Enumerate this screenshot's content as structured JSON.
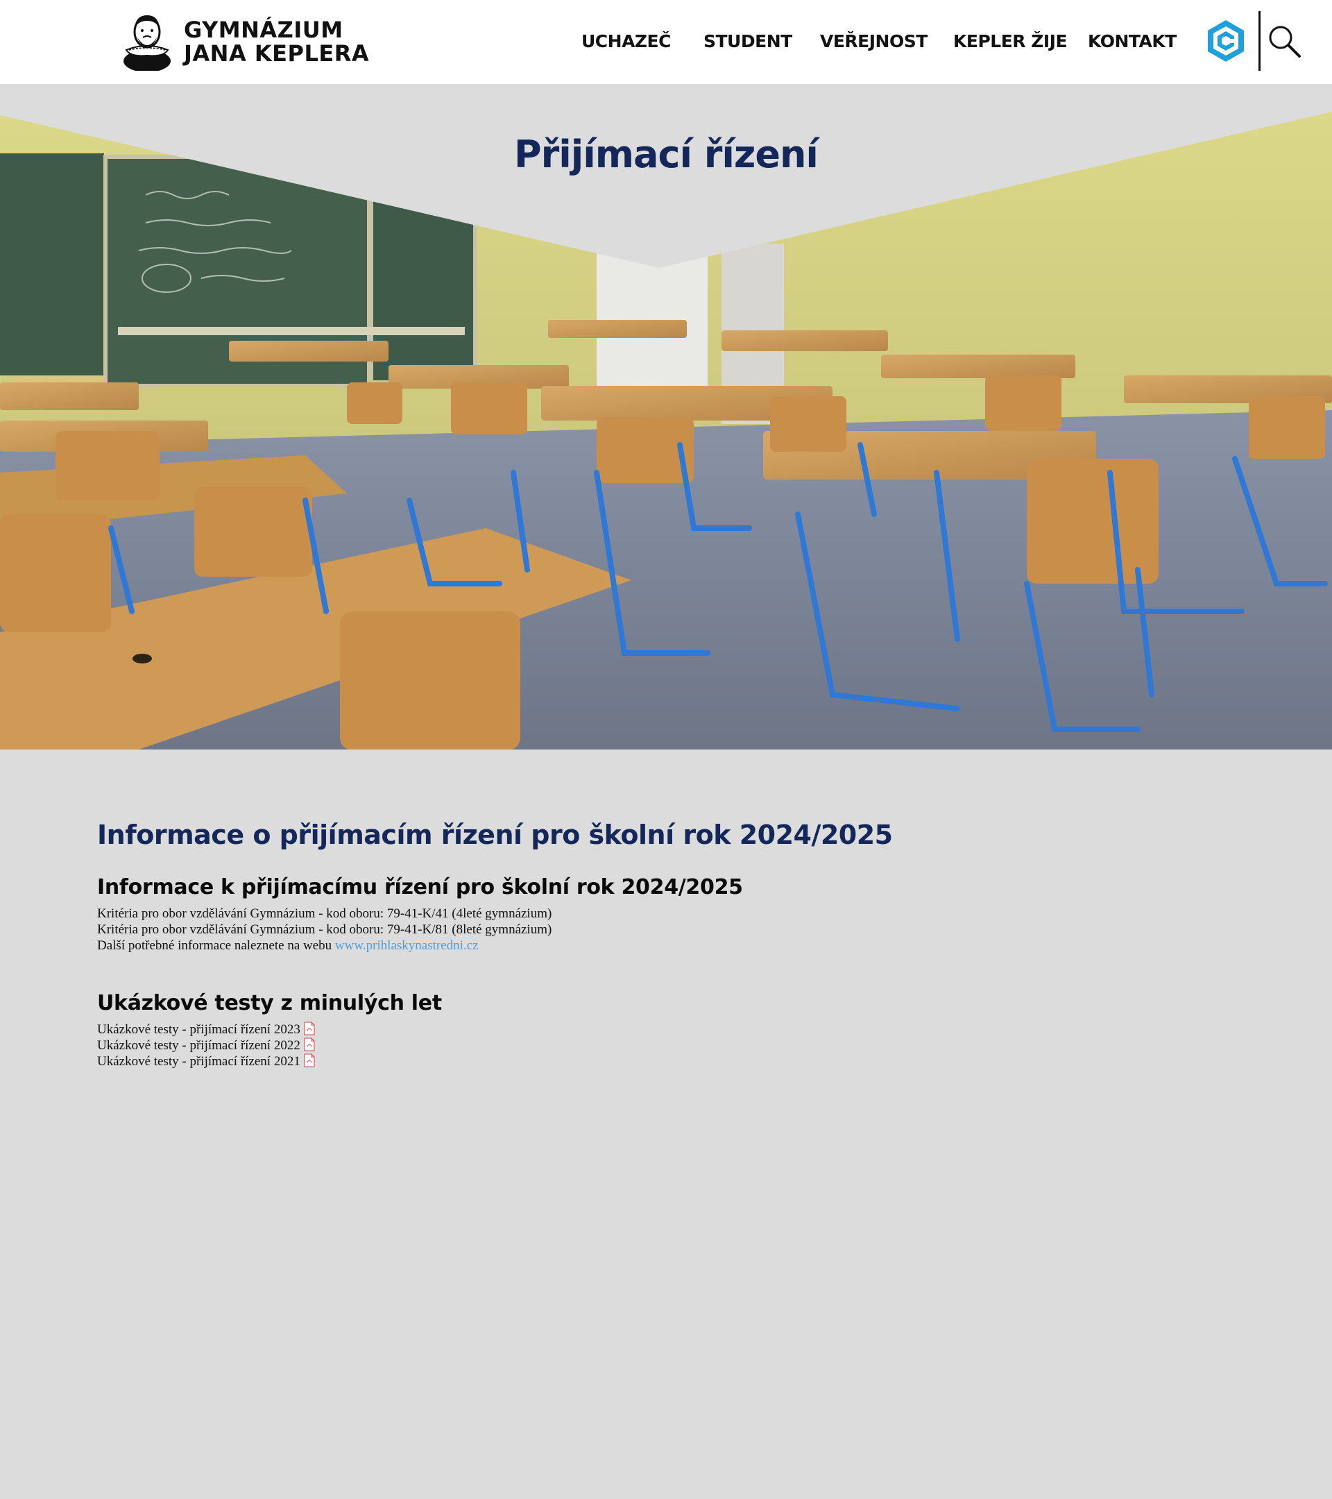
{
  "header": {
    "logo_line1": "GYMNÁZIUM",
    "logo_line2": "JANA KEPLERA",
    "nav": [
      {
        "label": "UCHAZEČ"
      },
      {
        "label": "STUDENT"
      },
      {
        "label": "VEŘEJNOST"
      },
      {
        "label": "KEPLER ŽIJE"
      },
      {
        "label": "KONTAKT"
      }
    ],
    "icons": {
      "bakalari": "bakalari-hexagon-icon",
      "search": "search-icon"
    }
  },
  "hero": {
    "title": "Přijímací řízení",
    "image": "classroom-photo"
  },
  "main": {
    "heading": "Informace o přijímacím řízení pro školní rok 2024/2025",
    "section1": {
      "heading": "Informace k přijímacímu řízení pro školní rok 2024/2025",
      "lines": [
        "Kritéria pro obor vzdělávání Gymnázium - kod oboru: 79-41-K/41 (4leté gymnázium)",
        "Kritéria pro obor vzdělávání Gymnázium - kod oboru: 79-41-K/81 (8leté gymnázium)"
      ],
      "more_text": "Další potřebné informace naleznete na webu ",
      "more_link": "www.prihlaskynastredni.cz"
    },
    "section2": {
      "heading": "Ukázkové testy z minulých let",
      "items": [
        "Ukázkové testy - přijímací řízení 2023",
        "Ukázkové testy - přijímací řízení 2022",
        "Ukázkové testy - přijímací řízení 2021"
      ]
    }
  },
  "colors": {
    "background": "#dcdcdc",
    "heading_blue": "#14275a",
    "link_blue": "#4a9fe0",
    "bakalari_blue": "#1e9fe0"
  }
}
